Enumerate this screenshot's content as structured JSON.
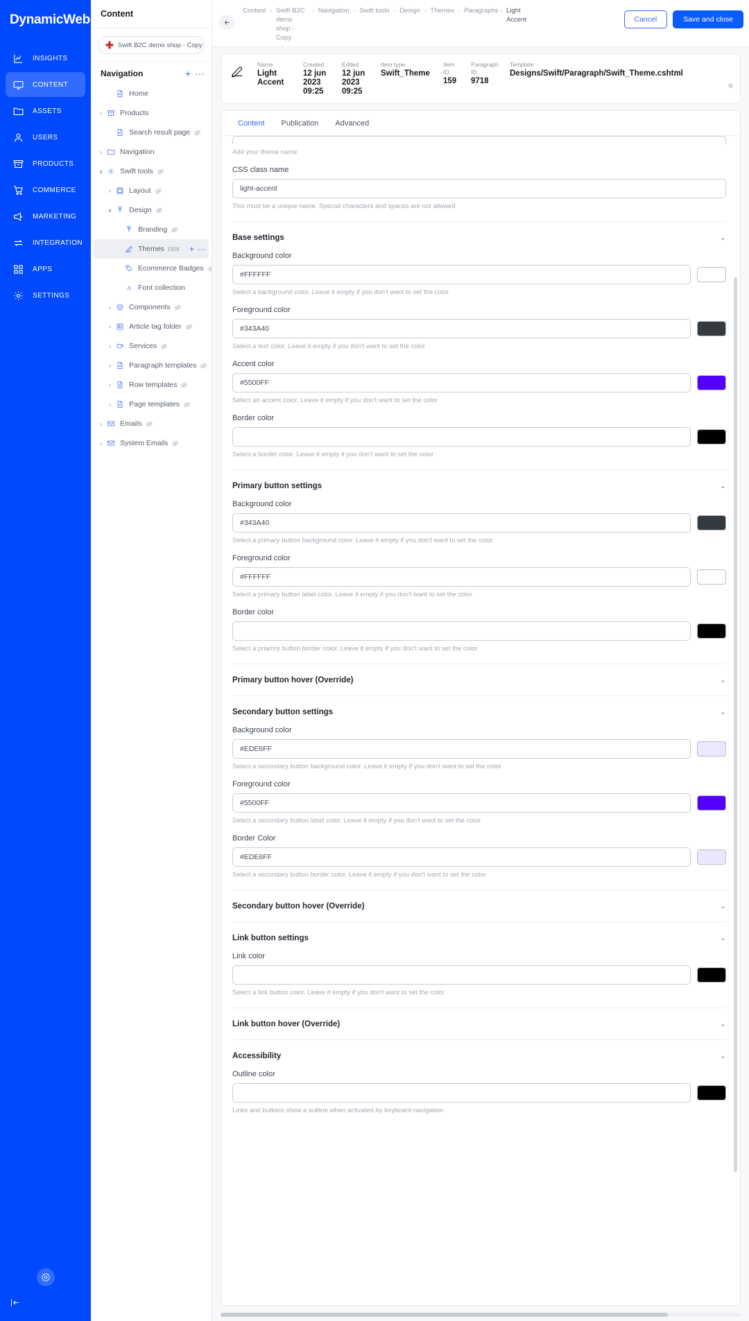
{
  "brand": "DynamicWeb",
  "rail": {
    "items": [
      {
        "label": "INSIGHTS",
        "icon": "chart-icon",
        "active": false
      },
      {
        "label": "CONTENT",
        "icon": "monitor-icon",
        "active": true
      },
      {
        "label": "ASSETS",
        "icon": "folder-icon",
        "active": false
      },
      {
        "label": "USERS",
        "icon": "user-icon",
        "active": false
      },
      {
        "label": "PRODUCTS",
        "icon": "box-icon",
        "active": false
      },
      {
        "label": "COMMERCE",
        "icon": "cart-icon",
        "active": false
      },
      {
        "label": "MARKETING",
        "icon": "megaphone-icon",
        "active": false
      },
      {
        "label": "INTEGRATION",
        "icon": "exchange-icon",
        "active": false
      },
      {
        "label": "APPS",
        "icon": "grid-icon",
        "active": false
      },
      {
        "label": "SETTINGS",
        "icon": "gear-icon",
        "active": false
      }
    ]
  },
  "tree_panel": {
    "header": "Content",
    "site_picker": "Swift B2C demo shop - Copy",
    "nav_title": "Navigation",
    "nav_add": "+",
    "nav_more": "···",
    "items": [
      {
        "label": "Home",
        "icon": "page-icon",
        "indent": 1,
        "twist": "",
        "hidden": false,
        "badge": ""
      },
      {
        "label": "Products",
        "icon": "box-icon",
        "indent": 0,
        "twist": "›",
        "hidden": false,
        "badge": ""
      },
      {
        "label": "Search result page",
        "icon": "page-icon",
        "indent": 1,
        "twist": "",
        "hidden": true,
        "badge": ""
      },
      {
        "label": "Navigation",
        "icon": "folder-icon",
        "indent": 0,
        "twist": "›",
        "hidden": false,
        "badge": ""
      },
      {
        "label": "Swift tools",
        "icon": "gear-icon",
        "indent": 0,
        "twist": "∨",
        "hidden": true,
        "badge": ""
      },
      {
        "label": "Layout",
        "icon": "layout-icon",
        "indent": 1,
        "twist": "›",
        "hidden": true,
        "badge": ""
      },
      {
        "label": "Design",
        "icon": "brush-icon",
        "indent": 1,
        "twist": "∨",
        "hidden": true,
        "badge": ""
      },
      {
        "label": "Branding",
        "icon": "brush-icon",
        "indent": 2,
        "twist": "",
        "hidden": true,
        "badge": ""
      },
      {
        "label": "Themes",
        "icon": "pencil-icon",
        "indent": 2,
        "twist": "",
        "hidden": false,
        "badge": "1908",
        "selected": true
      },
      {
        "label": "Ecommerce Badges",
        "icon": "tag-icon",
        "indent": 2,
        "twist": "",
        "hidden": true,
        "badge": ""
      },
      {
        "label": "Font collection",
        "icon": "font-icon",
        "indent": 2,
        "twist": "",
        "hidden": false,
        "badge": ""
      },
      {
        "label": "Components",
        "icon": "components-icon",
        "indent": 1,
        "twist": "›",
        "hidden": true,
        "badge": ""
      },
      {
        "label": "Article tag folder",
        "icon": "article-icon",
        "indent": 1,
        "twist": "›",
        "hidden": true,
        "badge": ""
      },
      {
        "label": "Services",
        "icon": "service-icon",
        "indent": 1,
        "twist": "›",
        "hidden": true,
        "badge": ""
      },
      {
        "label": "Paragraph templates",
        "icon": "page-icon",
        "indent": 1,
        "twist": "›",
        "hidden": true,
        "badge": ""
      },
      {
        "label": "Row templates",
        "icon": "page-icon",
        "indent": 1,
        "twist": "›",
        "hidden": true,
        "badge": ""
      },
      {
        "label": "Page templates",
        "icon": "page-icon",
        "indent": 1,
        "twist": "›",
        "hidden": true,
        "badge": ""
      },
      {
        "label": "Emails",
        "icon": "mail-icon",
        "indent": 0,
        "twist": "›",
        "hidden": true,
        "badge": ""
      },
      {
        "label": "System Emails",
        "icon": "mail-icon",
        "indent": 0,
        "twist": "›",
        "hidden": true,
        "badge": ""
      }
    ]
  },
  "topbar": {
    "breadcrumbs": [
      "Content",
      "Swift B2C demo shop - Copy",
      "Navigation",
      "Swift tools",
      "Design",
      "Themes",
      "Paragraphs",
      "Light Accent"
    ],
    "cancel_label": "Cancel",
    "save_label": "Save and close"
  },
  "info_card": {
    "name_label": "Name",
    "name_value": "Light Accent",
    "created_label": "Created",
    "created_value": "12 jun 2023 09:25",
    "edited_label": "Edited",
    "edited_value": "12 jun 2023 09:25",
    "item_type_label": "Item type",
    "item_type_value": "Swift_Theme",
    "item_id_label": "Item ID",
    "item_id_value": "159",
    "paragraph_id_label": "Paragraph ID",
    "paragraph_id_value": "9718",
    "template_label": "Template",
    "template_value": "Designs/Swift/Paragraph/Swift_Theme.cshtml"
  },
  "tabs": [
    {
      "label": "Content",
      "active": true
    },
    {
      "label": "Publication",
      "active": false
    },
    {
      "label": "Advanced",
      "active": false
    }
  ],
  "form": {
    "theme_name_help": "Add your theme name",
    "css_class": {
      "label": "CSS class name",
      "value": "light-accent",
      "help": "This must be a unique name. Special characters and spaces are not allowed"
    },
    "base_settings": {
      "title": "Base settings",
      "fields": [
        {
          "label": "Background color",
          "value": "#FFFFFF",
          "swatch": "#FFFFFF",
          "help": "Select a background color. Leave it empty if you don't want to set the color"
        },
        {
          "label": "Foreground color",
          "value": "#343A40",
          "swatch": "#343A40",
          "help": "Select a text color. Leave it empty if you don't want to set the color"
        },
        {
          "label": "Accent color",
          "value": "#5500FF",
          "swatch": "#5500FF",
          "help": "Select an accent color. Leave it empty if you don't want to set the color"
        },
        {
          "label": "Border color",
          "value": "",
          "swatch": "#000000",
          "help": "Select a border color. Leave it empty if you don't want to set the color"
        }
      ]
    },
    "primary_button": {
      "title": "Primary button settings",
      "fields": [
        {
          "label": "Background color",
          "value": "#343A40",
          "swatch": "#343A40",
          "help": "Select a primary button background color. Leave it empty if you don't want to set the color"
        },
        {
          "label": "Foreground color",
          "value": "#FFFFFF",
          "swatch": "#FFFFFF",
          "help": "Select a primary button label color. Leave it empty if you don't want to set the color"
        },
        {
          "label": "Border color",
          "value": "",
          "swatch": "#000000",
          "help": "Select a priamry button border color. Leave it empty if you don't want to set the color"
        }
      ]
    },
    "primary_hover": {
      "title": "Primary button hover (Override)"
    },
    "secondary_button": {
      "title": "Secondary button settings",
      "fields": [
        {
          "label": "Background color",
          "value": "#EDE6FF",
          "swatch": "#EDE6FF",
          "help": "Select a secondary button background color. Leave it empty if you don't want to set the color"
        },
        {
          "label": "Foreground color",
          "value": "#5500FF",
          "swatch": "#5500FF",
          "help": "Select a secondary button label color. Leave it empty if you don't want to set the color"
        },
        {
          "label": "Border Color",
          "value": "#EDE6FF",
          "swatch": "#EDE6FF",
          "help": "Select a secondary button border color. Leave it empty if you don't want to set the color"
        }
      ]
    },
    "secondary_hover": {
      "title": "Secondary button hover (Override)"
    },
    "link_button": {
      "title": "Link button settings",
      "fields": [
        {
          "label": "Link color",
          "value": "",
          "swatch": "#000000",
          "help": "Select a link button color. Leave it empty if you don't want to set the color"
        }
      ]
    },
    "link_hover": {
      "title": "Link button hover (Override)"
    },
    "accessibility": {
      "title": "Accessibility",
      "fields": [
        {
          "label": "Outline color",
          "value": "",
          "swatch": "#000000",
          "help": "Links and buttons show a outline when activated by keyboard navigation"
        }
      ]
    }
  }
}
